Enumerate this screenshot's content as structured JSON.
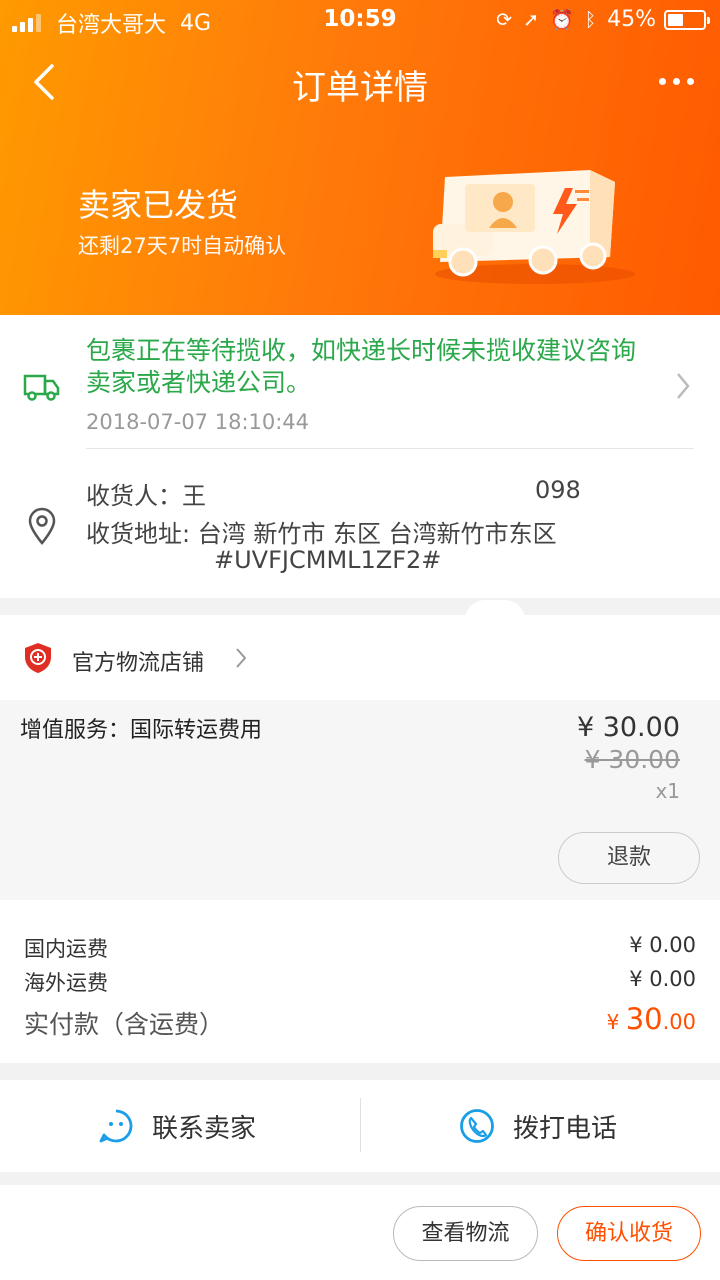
{
  "status_bar": {
    "carrier": "台湾大哥大",
    "network": "4G",
    "time": "10:59",
    "battery": "45%",
    "battery_level": 0.45
  },
  "nav": {
    "title": "订单详情"
  },
  "shipping": {
    "status": "卖家已发货",
    "countdown": "还剩27天7时自动确认"
  },
  "logistics": {
    "message": "包裹正在等待揽收，如快递长时候未揽收建议咨询卖家或者快递公司。",
    "time": "2018-07-07 18:10:44"
  },
  "address": {
    "receiver": "收货人：王",
    "phone": "098",
    "address_line1": "收货地址: 台湾 新竹市 东区 台湾新竹市东区",
    "address_line2": "#UVFJCMML1ZF2#"
  },
  "shop": {
    "name": "官方物流店铺"
  },
  "item": {
    "name": "增值服务：国际转运费用",
    "price": "¥ 30.00",
    "original_price": "¥ 30.00",
    "quantity": "x1",
    "refund_label": "退款"
  },
  "fees": {
    "domestic_label": "国内运费",
    "domestic_value": "¥ 0.00",
    "overseas_label": "海外运费",
    "overseas_value": "¥ 0.00",
    "paid_label": "实付款（含运费）",
    "paid_symbol": "¥ ",
    "paid_int": "30",
    "paid_dec": ".00"
  },
  "contact": {
    "seller_label": "联系卖家",
    "call_label": "拨打电话"
  },
  "actions": {
    "view_logistics": "查看物流",
    "confirm_receipt": "确认收货"
  },
  "colors": {
    "accent": "#ff5000",
    "header_start": "#ff9a00",
    "logistics_green": "#2aa84a"
  }
}
